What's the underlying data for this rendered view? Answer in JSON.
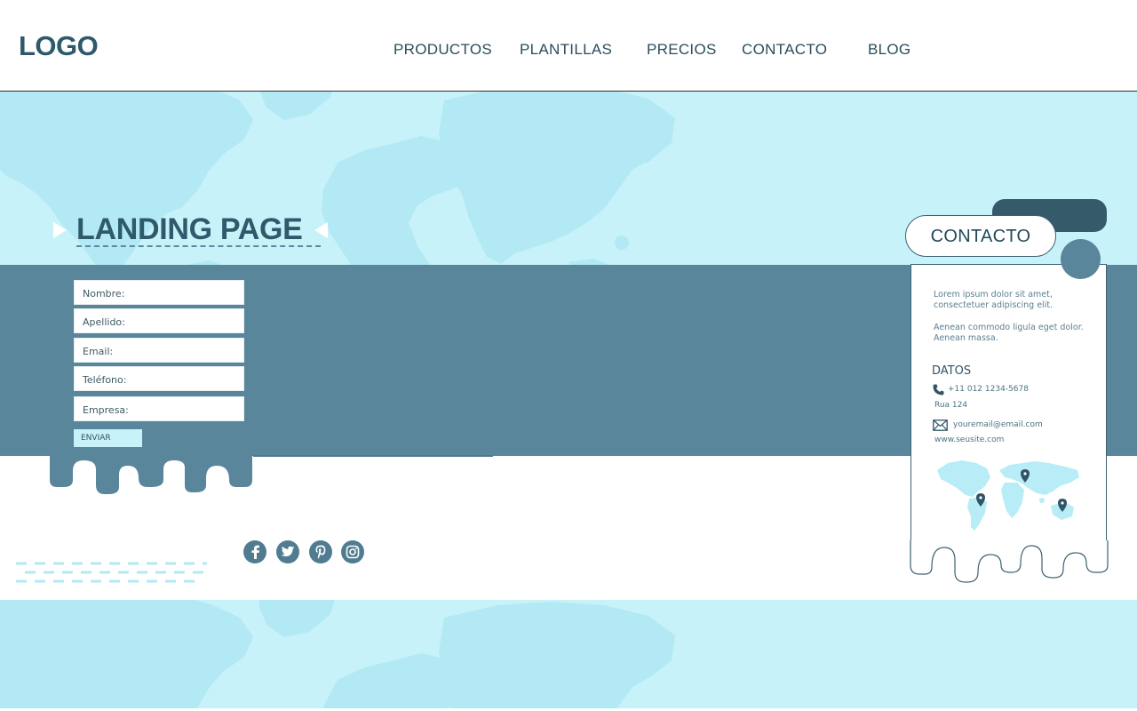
{
  "header": {
    "logo": "LOGO",
    "nav": [
      "PRODUCTOS",
      "PLANTILLAS",
      "PRECIOS",
      "CONTACTO",
      "BLOG"
    ]
  },
  "hero": {
    "title": "LANDING PAGE"
  },
  "form": {
    "fields": [
      "Nombre:",
      "Apellido:",
      "Email:",
      "Teléfono:",
      "Empresa:"
    ],
    "submit": "ENVIAR"
  },
  "social": [
    "facebook-icon",
    "twitter-icon",
    "pinterest-icon",
    "instagram-icon"
  ],
  "contact_card": {
    "heading": "CONTACTO",
    "paragraph1": "Lorem ipsum dolor sit amet, consectetuer adipiscing elit.",
    "paragraph2": "Aenean commodo ligula eget dolor. Aenean massa.",
    "datos_label": "DATOS",
    "phone": "+11 012 1234-5678",
    "address": "Rua 124",
    "email": "youremail@email.com",
    "website": "www.seusite.com"
  },
  "colors": {
    "hero_bg": "#c8f2f9",
    "map_light": "#b2e9f4",
    "band": "#5a869b",
    "dark_accent": "#355b6b",
    "title": "#2f5a6b"
  }
}
